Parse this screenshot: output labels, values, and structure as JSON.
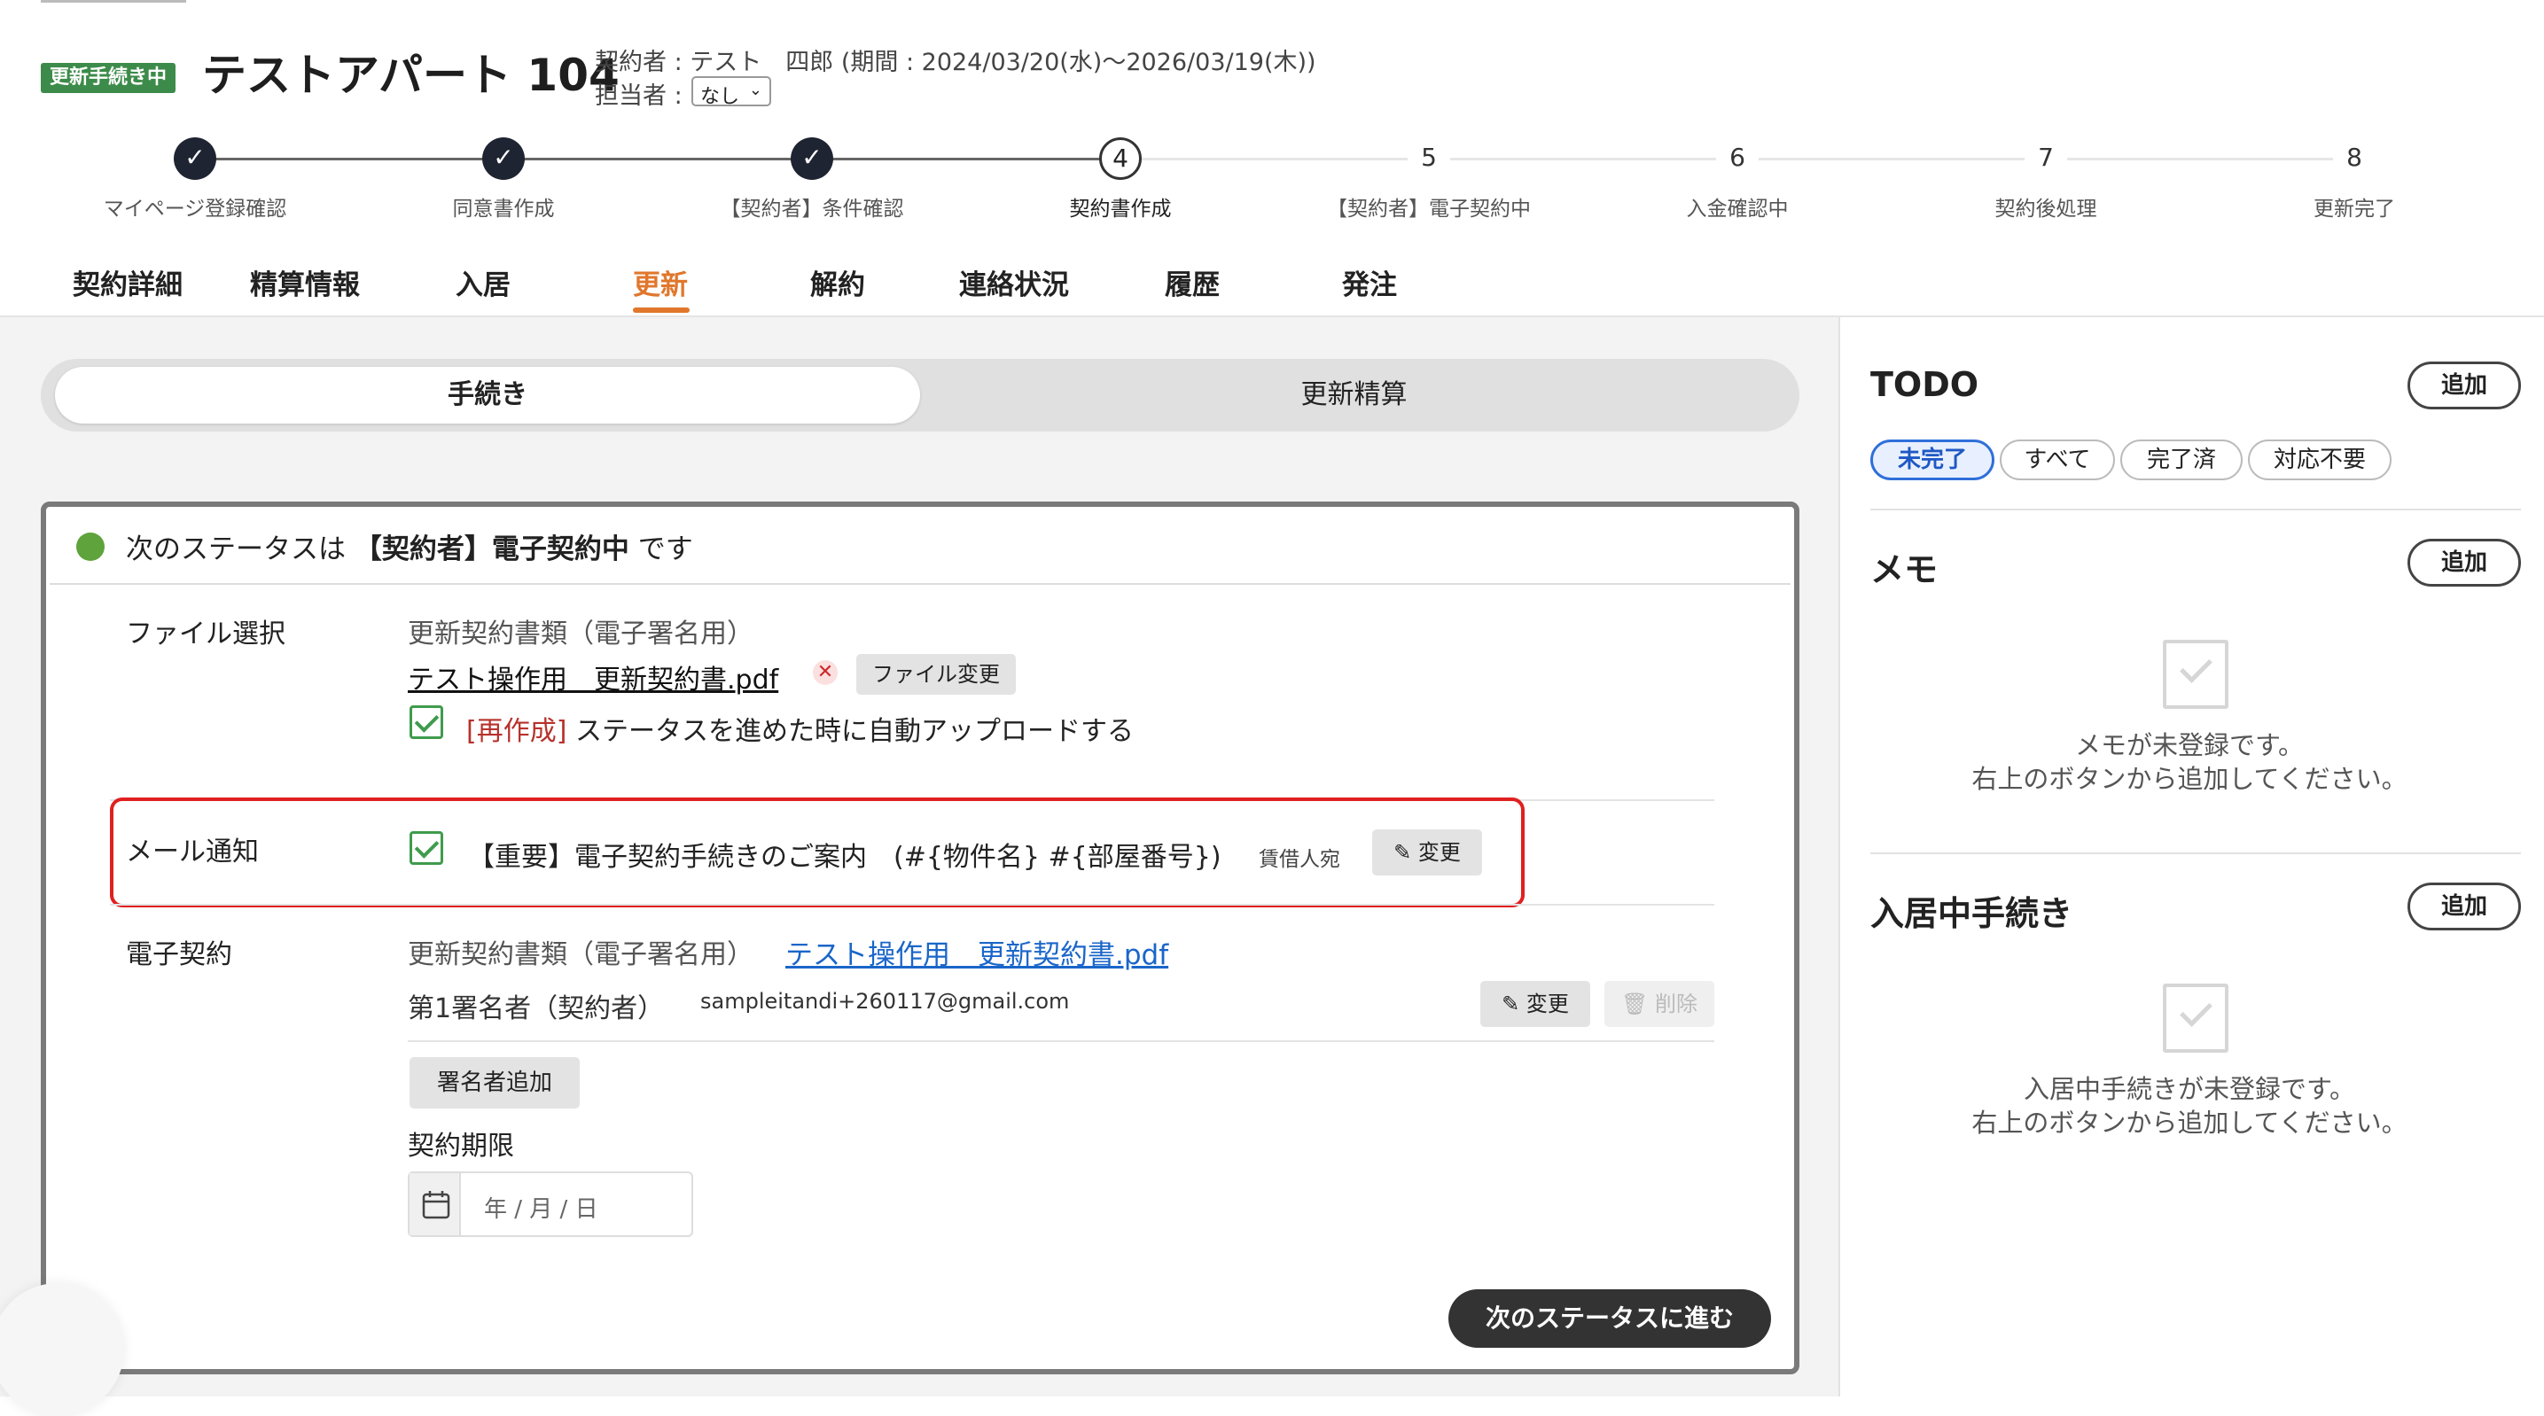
{
  "header": {
    "badge": "更新手続き中",
    "title": "テストアパート 104",
    "contract_info": "契約者 : テスト　四郎 (期間 : 2024/03/20(水)〜2026/03/19(木))",
    "assignee_label": "担当者 :",
    "assignee_value": "なし"
  },
  "stepper": {
    "steps": [
      {
        "number": "1",
        "label": "マイページ登録確認",
        "state": "done"
      },
      {
        "number": "2",
        "label": "同意書作成",
        "state": "done"
      },
      {
        "number": "3",
        "label": "【契約者】条件確認",
        "state": "done"
      },
      {
        "number": "4",
        "label": "契約書作成",
        "state": "current"
      },
      {
        "number": "5",
        "label": "【契約者】電子契約中",
        "state": "future"
      },
      {
        "number": "6",
        "label": "入金確認中",
        "state": "future"
      },
      {
        "number": "7",
        "label": "契約後処理",
        "state": "future"
      },
      {
        "number": "8",
        "label": "更新完了",
        "state": "future"
      }
    ]
  },
  "tabs": [
    "契約詳細",
    "精算情報",
    "入居",
    "更新",
    "解約",
    "連絡状況",
    "履歴",
    "発注"
  ],
  "active_tab": "更新",
  "subtabs": {
    "procedure": "手続き",
    "settlement": "更新精算"
  },
  "status": {
    "prefix": "次のステータスは",
    "name": "【契約者】電子契約中",
    "suffix": "です",
    "dot_color": "#5ea33b"
  },
  "file_section": {
    "label": "ファイル選択",
    "doc_type": "更新契約書類（電子署名用）",
    "file_name": "テスト操作用　更新契約書.pdf",
    "change_button": "ファイル変更",
    "regen_tag": "[再作成]",
    "regen_text": "ステータスを進めた時に自動アップロードする"
  },
  "mail_section": {
    "label": "メール通知",
    "subject": "【重要】電子契約手続きのご案内　(#{物件名} #{部屋番号})",
    "recipient": "賃借人宛",
    "change_button": "変更"
  },
  "esign_section": {
    "label": "電子契約",
    "doc_type": "更新契約書類（電子署名用）",
    "file_link": "テスト操作用　更新契約書.pdf",
    "signer_label": "第1署名者（契約者）",
    "signer_email": "sampleitandi+260117@gmail.com",
    "change_button": "変更",
    "delete_button": "削除",
    "add_signer_button": "署名者追加",
    "deadline_label": "契約期限",
    "date_placeholder": "年 / 月 / 日"
  },
  "next_button": "次のステータスに進む",
  "sidebar": {
    "todo": {
      "title": "TODO",
      "add": "追加",
      "filters": [
        "未完了",
        "すべて",
        "完了済",
        "対応不要"
      ],
      "active_filter": "未完了"
    },
    "memo": {
      "title": "メモ",
      "add": "追加",
      "empty_line1": "メモが未登録です。",
      "empty_line2": "右上のボタンから追加してください。"
    },
    "moving": {
      "title": "入居中手続き",
      "add": "追加",
      "empty_line1": "入居中手続きが未登録です。",
      "empty_line2": "右上のボタンから追加してください。"
    }
  },
  "colors": {
    "accent": "#e0772c",
    "badge_green": "#3d8b4a",
    "link_blue": "#1a66c9",
    "highlight_red": "#e02020"
  }
}
